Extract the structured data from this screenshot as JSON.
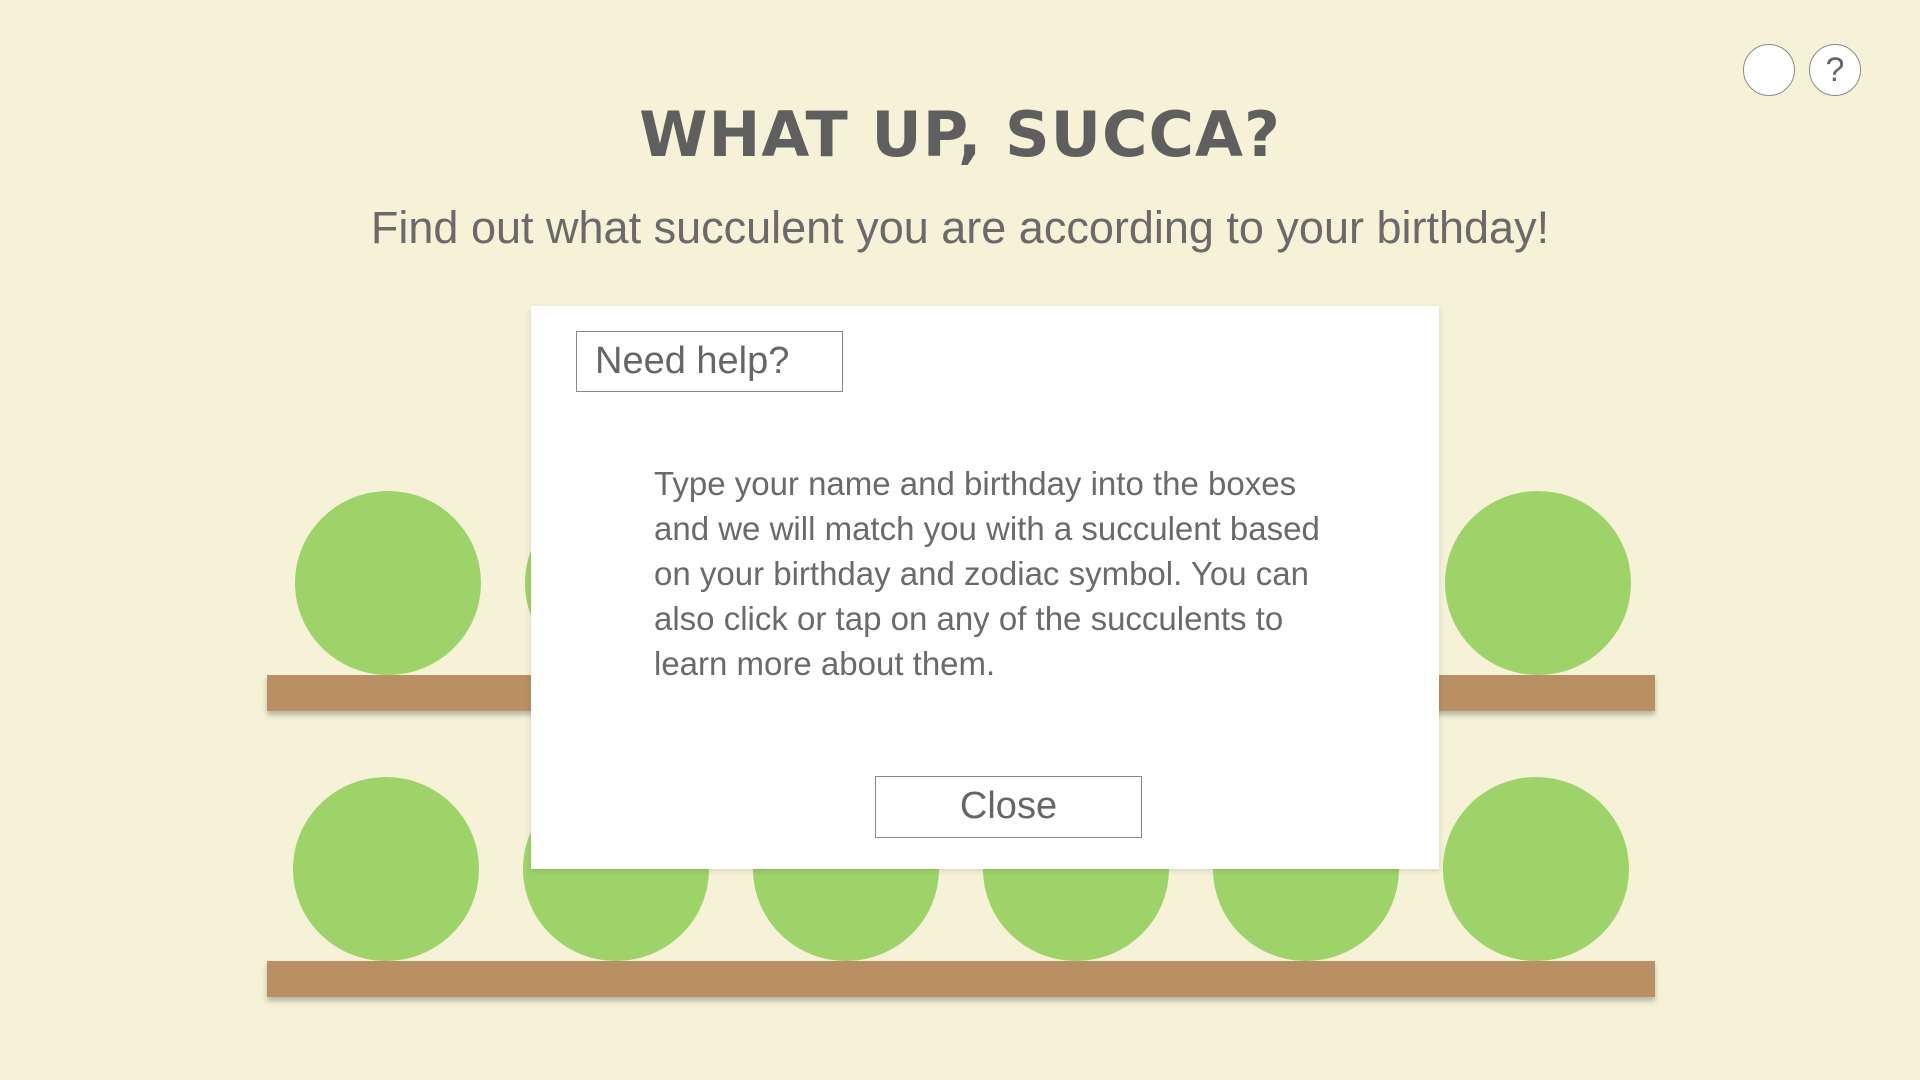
{
  "header": {
    "title": "WHAT UP, SUCCA?",
    "subtitle": "Find out what succulent you are according to your birthday!"
  },
  "top_controls": {
    "blank_button_label": "",
    "help_button_label": "?"
  },
  "modal": {
    "heading": "Need help?",
    "body": "Type your name and birthday into the boxes and we will match you with a succulent based on your birthday and zodiac symbol. You can also click or tap on any of the succulents to learn more about them.",
    "close_label": "Close"
  },
  "shelves": {
    "top_row_plants": 6,
    "bottom_row_plants": 6
  },
  "colors": {
    "background": "#f6f2d8",
    "plant": "#9ed36a",
    "shelf": "#b89063",
    "text": "#666666"
  }
}
